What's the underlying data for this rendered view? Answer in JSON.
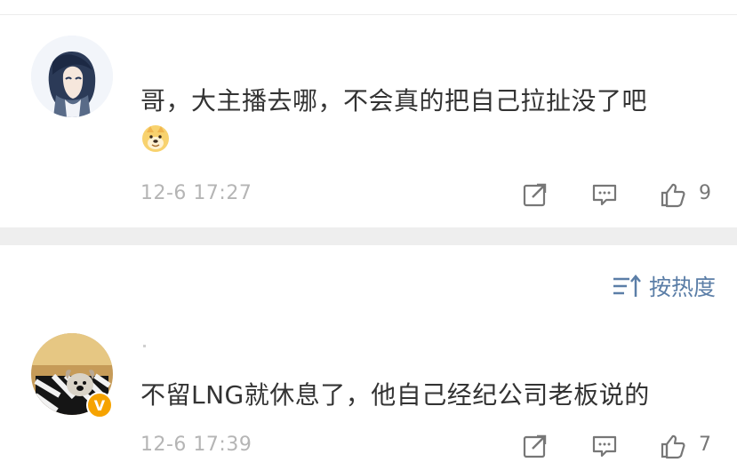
{
  "comments": [
    {
      "text": "哥，大主播去哪，不会真的把自己拉扯没了吧",
      "time": "12-6 17:27",
      "likes": "9",
      "emoji": "doge-emoji",
      "avatar": "anime-avatar"
    },
    {
      "text": "不留LNG就休息了，他自己经纪公司老板说的",
      "time": "12-6 17:39",
      "likes": "7",
      "avatar": "dog-avatar",
      "badge": "V"
    }
  ],
  "sort": {
    "label": "按热度"
  },
  "icons": {
    "repost": "repost-icon",
    "reply": "comment-icon",
    "like": "thumb-up-icon",
    "sort": "sort-icon"
  },
  "colors": {
    "accent": "#5b7ea7",
    "meta": "#b5b5b5",
    "text": "#333333",
    "badge": "#f6a300"
  }
}
